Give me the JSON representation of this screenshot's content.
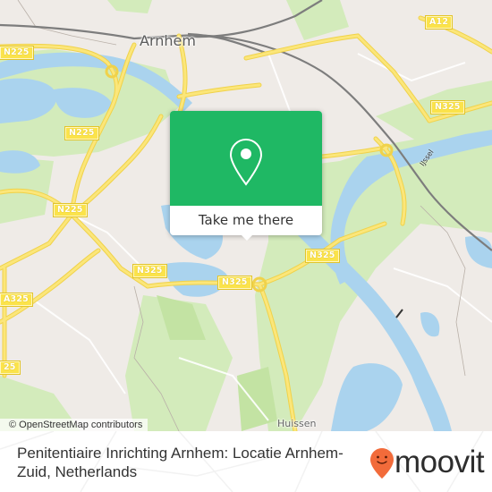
{
  "map": {
    "city_label": "Arnhem",
    "town_label": "Huissen",
    "river_label": "IJssel",
    "road_shields": [
      {
        "id": "n225-top-left",
        "label": "N225"
      },
      {
        "id": "n225-mid-left",
        "label": "N225"
      },
      {
        "id": "n225-center-left",
        "label": "N225"
      },
      {
        "id": "a12",
        "label": "A12"
      },
      {
        "id": "n325-right",
        "label": "N325"
      },
      {
        "id": "n325-east",
        "label": "N325"
      },
      {
        "id": "n325-center",
        "label": "N325"
      },
      {
        "id": "n325-south",
        "label": "N325"
      },
      {
        "id": "a325-left",
        "label": "A325"
      },
      {
        "id": "n325-far-left",
        "label": "25"
      }
    ],
    "attribution": "© OpenStreetMap contributors"
  },
  "popup": {
    "icon": "location-pin-icon",
    "cta_label": "Take me there"
  },
  "footer": {
    "place_name": "Penitentiaire Inrichting Arnhem: Locatie Arnhem-Zuid, Netherlands",
    "brand": "moovit"
  },
  "colors": {
    "popup_green": "#1fb864",
    "brand_orange": "#f26b3a",
    "water": "#aad3ee",
    "park": "#cde8b0",
    "road": "#fbe34b"
  }
}
